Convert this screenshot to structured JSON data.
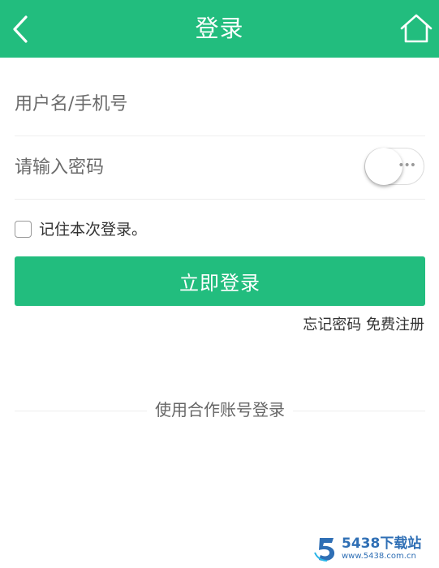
{
  "header": {
    "title": "登录",
    "back_icon": "chevron-left-icon",
    "home_icon": "home-icon",
    "background": "#22bd7e"
  },
  "form": {
    "username_placeholder": "用户名/手机号",
    "password_placeholder": "请输入密码",
    "password_visibility_toggle": "off",
    "remember_label": "记住本次登录。",
    "remember_checked": false,
    "submit_label": "立即登录"
  },
  "links": {
    "forgot_password": "忘记密码",
    "register": "免费注册"
  },
  "third_party": {
    "label": "使用合作账号登录"
  },
  "watermark": {
    "text": "5438下载站",
    "url": "www.5438.com.cn"
  },
  "colors": {
    "accent": "#22bd7e",
    "watermark": "#2f6fb5"
  }
}
